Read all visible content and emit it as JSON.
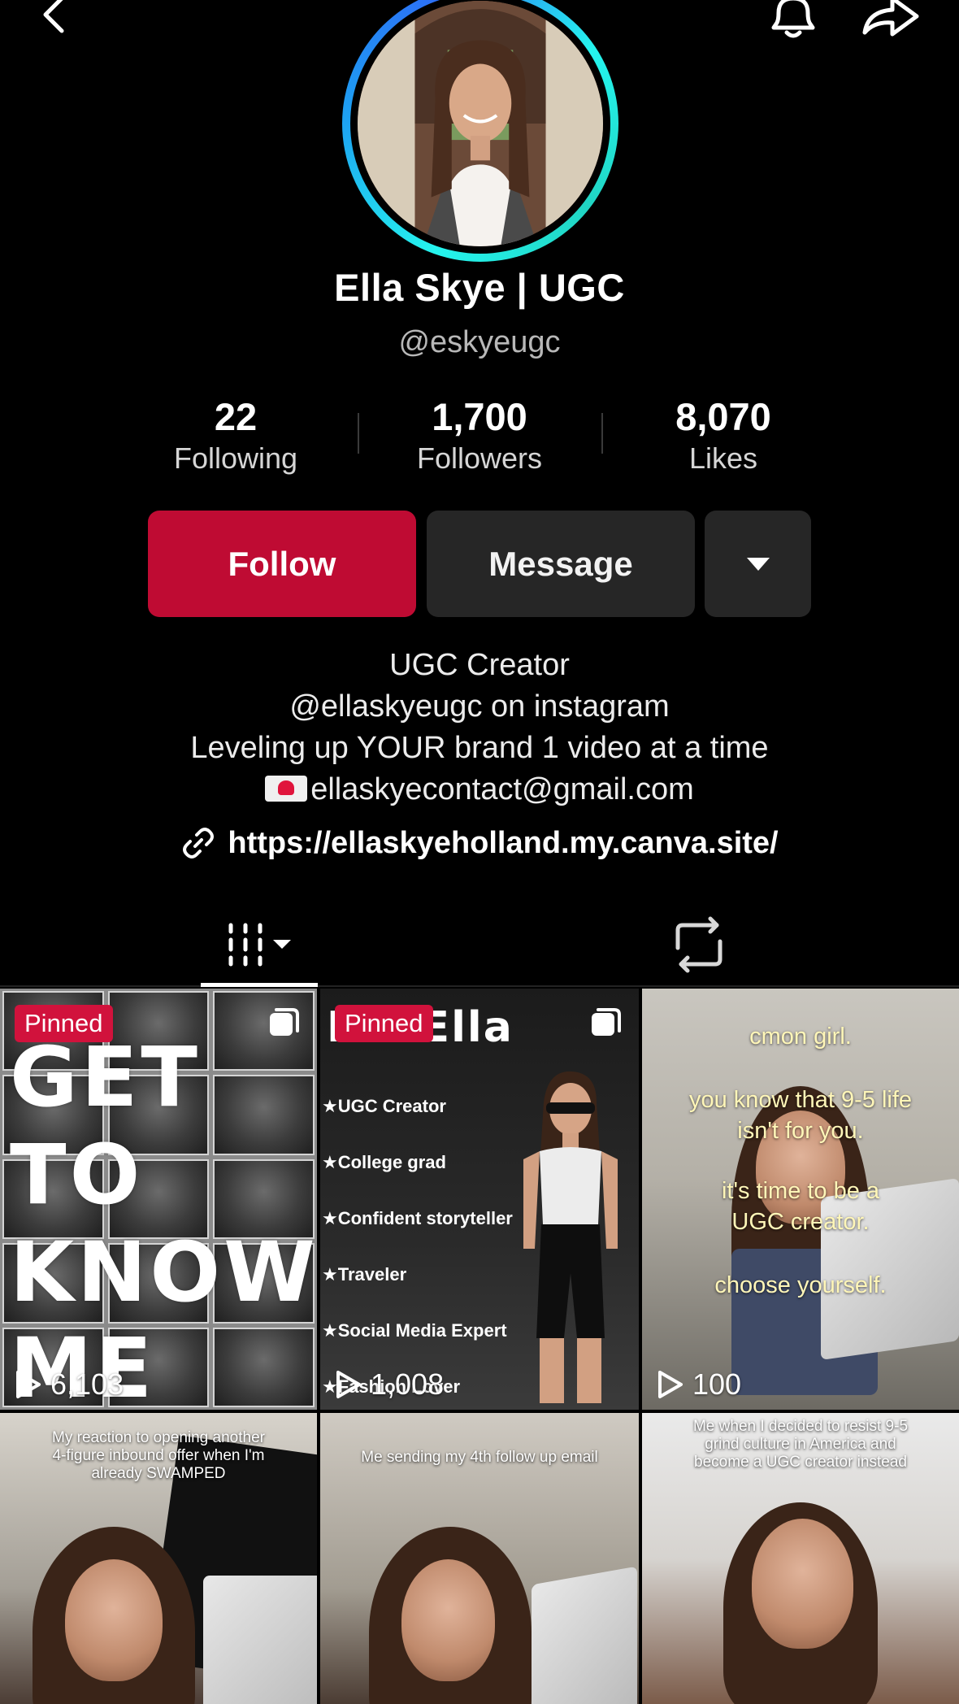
{
  "header": {
    "back_icon": "chevron-left-icon",
    "bell_icon": "bell-icon",
    "share_icon": "share-arrow-icon"
  },
  "profile": {
    "display_name": "Ella Skye | UGC",
    "username": "@eskyeugc"
  },
  "stats": [
    {
      "value": "22",
      "label": "Following"
    },
    {
      "value": "1,700",
      "label": "Followers"
    },
    {
      "value": "8,070",
      "label": "Likes"
    }
  ],
  "actions": {
    "follow_label": "Follow",
    "message_label": "Message",
    "follow_color": "#bf0b33"
  },
  "bio": {
    "line1": "UGC Creator",
    "line2": "@ellaskyeugc on instagram",
    "line3": "Leveling up YOUR brand 1 video at a time",
    "email": "ellaskyecontact@gmail.com",
    "link": "https://ellaskyeholland.my.canva.site/"
  },
  "tabs": {
    "videos_icon": "grid-bars-icon",
    "reposts_icon": "repost-icon"
  },
  "videos": [
    {
      "pinned": "Pinned",
      "views": "6,103",
      "overlay": [
        "GET",
        "TO",
        "KNOW",
        "ME"
      ]
    },
    {
      "pinned": "Pinned",
      "views": "1,008",
      "overlay_title": "I'm Ella",
      "list": [
        "UGC Creator",
        "College grad",
        "Confident storyteller",
        "Traveler",
        "Social Media Expert",
        "Fashion Lover"
      ]
    },
    {
      "views": "100",
      "captions": [
        "cmon girl.",
        "you know that 9-5 life isn't for you.",
        "it's time to be a UGC creator.",
        "choose yourself."
      ]
    },
    {
      "caption": "My reaction to opening another 4-figure inbound offer when I'm already SWAMPED"
    },
    {
      "caption": "Me sending my 4th follow up email"
    },
    {
      "caption": "Me when I decided to resist 9-5 grind culture in America and become a UGC creator instead"
    }
  ]
}
